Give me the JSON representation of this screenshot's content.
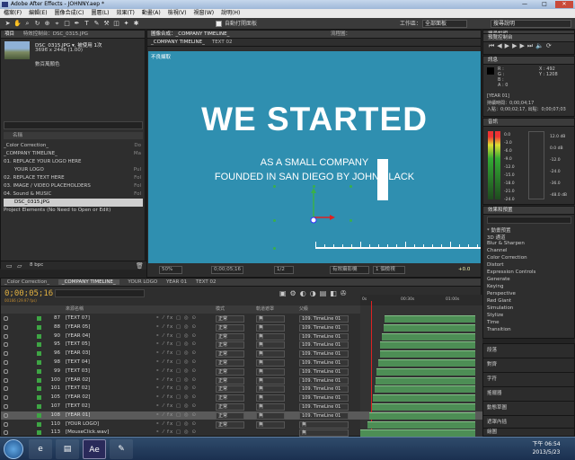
{
  "window": {
    "title": "Adobe After Effects - JOHNNY.aep *",
    "minimize": "—",
    "maximize": "□",
    "close": "✕"
  },
  "menu": [
    "檔案(F)",
    "編輯(E)",
    "圖像合成(C)",
    "圖層(L)",
    "效果(T)",
    "動畫(A)",
    "檢視(V)",
    "視窗(W)",
    "說明(H)"
  ],
  "toolbar": {
    "auto_open": "自動打開面板",
    "workspace_label": "工作區：",
    "workspace_value": "全部面板",
    "search_placeholder": "搜尋說明"
  },
  "project": {
    "tab": "項目",
    "effects_tab": "特效控制台：DSC_0315.JPG",
    "file_name": "DSC_0315.JPG ▾, 被使用 1次",
    "file_dims": "3696 x 2448 (1.00)",
    "file_color": "數百萬顏色",
    "head_name": "名稱",
    "rows": [
      {
        "name": "_Color Correction_",
        "type": "Do"
      },
      {
        "name": "_COMPANY TIMELINE_",
        "type": "Ma"
      },
      {
        "name": "01. REPLACE YOUR LOGO HERE",
        "type": ""
      },
      {
        "name": "YOUR LOGO",
        "type": "Pul"
      },
      {
        "name": "02. REPLACE TEXT HERE",
        "type": "Fol"
      },
      {
        "name": "03. IMAGE / VIDEO PLACEHOLDERS",
        "type": "Fol"
      },
      {
        "name": "04. Sound & MUSIC",
        "type": "Fol"
      },
      {
        "name": "DSC_0315.JPG",
        "type": ""
      },
      {
        "name": "Project Elements (No Need to Open or Edit)",
        "type": ""
      }
    ],
    "bpc": "8 bpc"
  },
  "comp": {
    "tab_label": "圖像合成：_COMPANY TIMELINE_",
    "subtab": "_COMPANY TIMELINE_",
    "subtab2": "TEXT 02",
    "flow": "流程圖：",
    "viewer_label": "不良擷取",
    "headline": "WE STARTED",
    "line2": "AS A SMALL COMPANY",
    "line3": "FOUNDED IN SAN DIEGO BY JOHN BLACK",
    "zoom": "50%",
    "time": "0;00;05;16",
    "res": "1/2",
    "camera": "有效攝影機",
    "views": "1 個檢視",
    "exposure": "+0.0"
  },
  "right": {
    "preview": "預覽控制台",
    "info": "訊息",
    "info_r": "R :",
    "info_g": "G :",
    "info_b": "B :",
    "info_a": "A : 0",
    "info_x": "X : 492",
    "info_y": "Y : 1208",
    "info_layer": "[YEAR 01]",
    "info_dur": "持續時間：0;00;04;17",
    "info_in": "入點：0;00;02;17, 出點：0;00;07;03",
    "audio": "音訊",
    "audio_levels": [
      "0.0",
      "-3.0",
      "-6.0",
      "-9.0",
      "-12.0",
      "-15.0",
      "-18.0",
      "-21.0",
      "-24.0"
    ],
    "audio_db": [
      "12.0 dB",
      "0.0 dB",
      "-12.0",
      "-24.0",
      "-36.0",
      "-48.0 dB"
    ],
    "effects_hdr": "效果和預置",
    "effects": [
      "* 動畫預置",
      "3D 通道",
      "Blur & Sharpen",
      "Channel",
      "Color Correction",
      "Distort",
      "Expression Controls",
      "Generate",
      "Keying",
      "Perspective",
      "Red Giant",
      "Simulation",
      "Stylize",
      "Time",
      "Transition"
    ],
    "side_panels": [
      "段落",
      "對齊",
      "字符",
      "搖擺器",
      "動態草圖",
      "遮罩內插",
      "繪圖"
    ]
  },
  "timeline": {
    "time": "0;00;05;16",
    "sub": "00166 (29.97 fps)",
    "tabs": [
      "_Color Correction_",
      "_COMPANY TIMELINE_",
      "YOUR LOGO",
      "YEAR 01",
      "TEXT 02"
    ],
    "head_src": "來源名稱",
    "head_mode": "模式",
    "head_trk": "軌道遮罩",
    "head_par": "父級",
    "ruler": [
      "0s",
      "00:30s",
      "01:00s"
    ],
    "layers": [
      {
        "num": "87",
        "name": "[TEXT 07]",
        "mode": "正常",
        "trk": "無",
        "par": "109. TimeLine 01"
      },
      {
        "num": "88",
        "name": "[YEAR 05]",
        "mode": "正常",
        "trk": "無",
        "par": "109. TimeLine 01"
      },
      {
        "num": "90",
        "name": "[YEAR 04]",
        "mode": "正常",
        "trk": "無",
        "par": "109. TimeLine 01"
      },
      {
        "num": "95",
        "name": "[TEXT 05]",
        "mode": "正常",
        "trk": "無",
        "par": "109. TimeLine 01"
      },
      {
        "num": "96",
        "name": "[YEAR 03]",
        "mode": "正常",
        "trk": "無",
        "par": "109. TimeLine 01"
      },
      {
        "num": "98",
        "name": "[TEXT 04]",
        "mode": "正常",
        "trk": "無",
        "par": "109. TimeLine 01"
      },
      {
        "num": "99",
        "name": "[TEXT 03]",
        "mode": "正常",
        "trk": "無",
        "par": "109. TimeLine 01"
      },
      {
        "num": "100",
        "name": "[YEAR 02]",
        "mode": "正常",
        "trk": "無",
        "par": "109. TimeLine 01"
      },
      {
        "num": "101",
        "name": "[TEXT 02]",
        "mode": "正常",
        "trk": "無",
        "par": "109. TimeLine 01"
      },
      {
        "num": "105",
        "name": "[YEAR 02]",
        "mode": "正常",
        "trk": "無",
        "par": "109. TimeLine 01"
      },
      {
        "num": "107",
        "name": "[TEXT 02]",
        "mode": "正常",
        "trk": "無",
        "par": "109. TimeLine 01"
      },
      {
        "num": "108",
        "name": "[YEAR 01]",
        "mode": "正常",
        "trk": "無",
        "par": "109. TimeLine 01"
      },
      {
        "num": "110",
        "name": "[YOUR LOGO]",
        "mode": "正常",
        "trk": "無",
        "par": "無"
      },
      {
        "num": "113",
        "name": "[MouseClick.wav]",
        "mode": "",
        "trk": "",
        "par": "無"
      }
    ]
  },
  "taskbar": {
    "time": "下午 06:54",
    "date": "2013/5/23",
    "ae_label": "Ae"
  }
}
